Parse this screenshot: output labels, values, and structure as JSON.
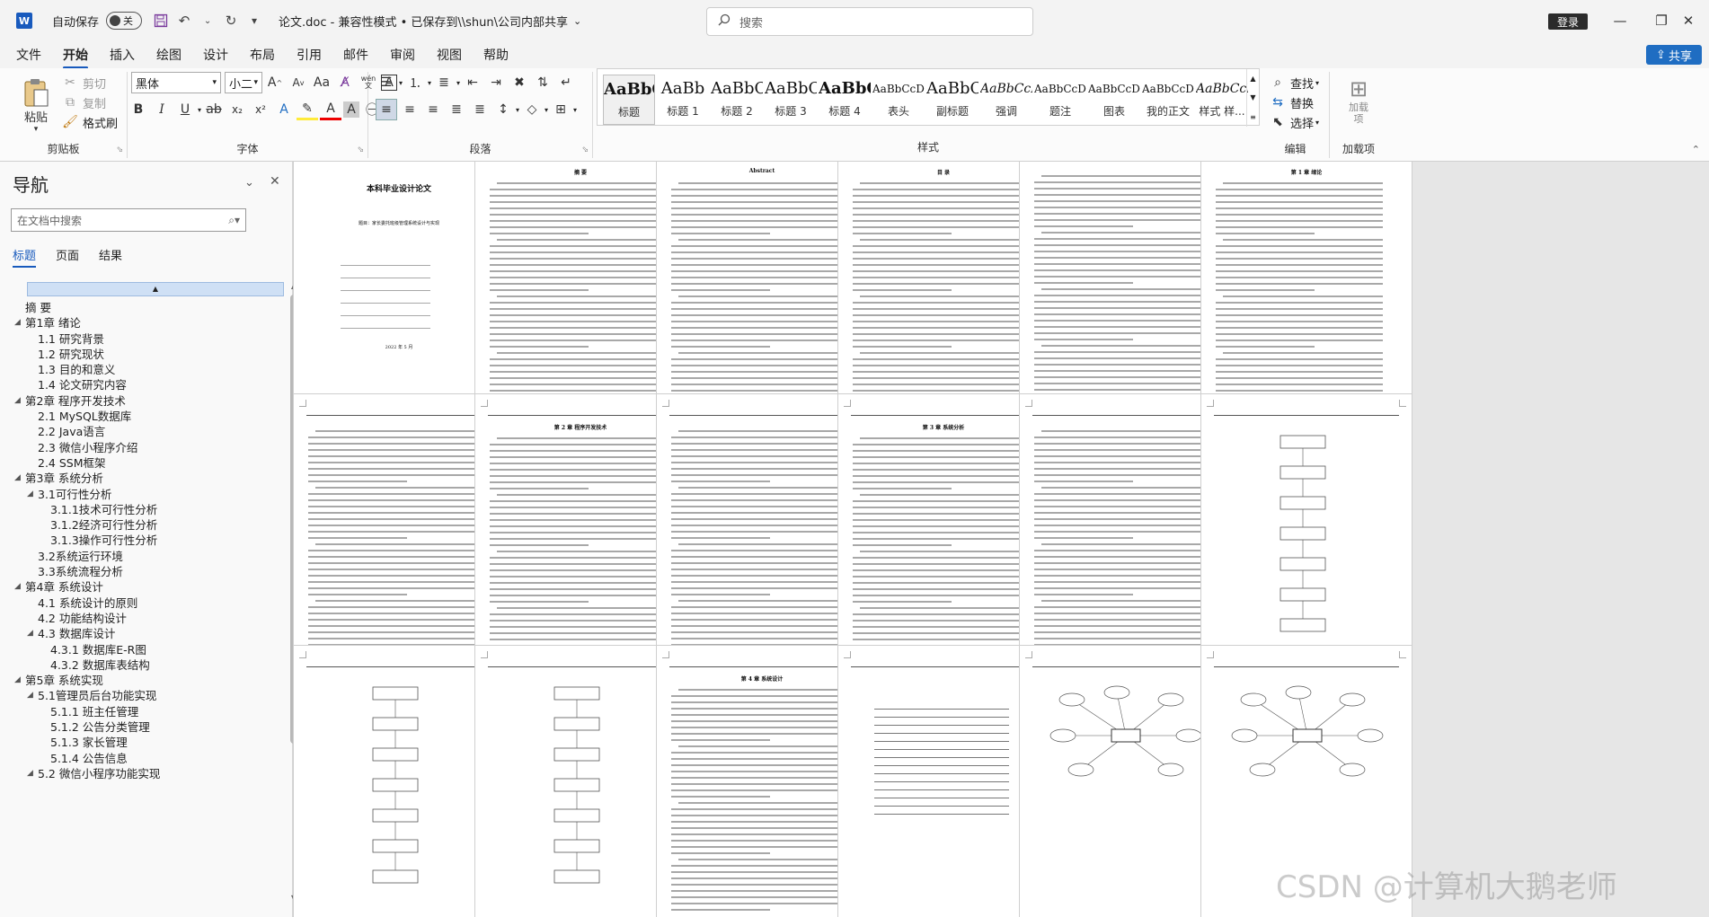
{
  "titlebar": {
    "autosave_label": "自动保存",
    "autosave_state": "关",
    "document_title": "论文.doc  -  兼容性模式 • 已保存到\\\\shun\\公司内部共享",
    "search_placeholder": "搜索",
    "login_label": "登录"
  },
  "menu": {
    "tabs": [
      "文件",
      "开始",
      "插入",
      "绘图",
      "设计",
      "布局",
      "引用",
      "邮件",
      "审阅",
      "视图",
      "帮助"
    ],
    "active": "开始",
    "share_label": "共享"
  },
  "ribbon": {
    "clipboard": {
      "paste": "粘贴",
      "cut": "剪切",
      "copy": "复制",
      "format_painter": "格式刷",
      "label": "剪贴板"
    },
    "font": {
      "name": "黑体",
      "size": "小二",
      "label": "字体",
      "case_label": "Aa",
      "pinyin": "wén"
    },
    "paragraph": {
      "label": "段落"
    },
    "styles": {
      "label": "样式",
      "items": [
        {
          "sample": "AaBbC",
          "name": "标题"
        },
        {
          "sample": "AaBb",
          "name": "标题 1"
        },
        {
          "sample": "AaBbC",
          "name": "标题 2"
        },
        {
          "sample": "AaBbC",
          "name": "标题 3"
        },
        {
          "sample": "AaBbC",
          "name": "标题 4"
        },
        {
          "sample": "AaBbCcDd",
          "name": "表头"
        },
        {
          "sample": "AaBbC",
          "name": "副标题"
        },
        {
          "sample": "AaBbCcI",
          "name": "强调"
        },
        {
          "sample": "AaBbCcDd",
          "name": "题注"
        },
        {
          "sample": "AaBbCcDd",
          "name": "图表"
        },
        {
          "sample": "AaBbCcDd",
          "name": "我的正文"
        },
        {
          "sample": "AaBbCcI",
          "name": "样式 样..."
        }
      ]
    },
    "editing": {
      "find": "查找",
      "replace": "替换",
      "select": "选择",
      "label": "编辑"
    },
    "addins": {
      "button": "加载项",
      "label": "加载项"
    }
  },
  "nav": {
    "title": "导航",
    "search_placeholder": "在文档中搜索",
    "tabs": [
      "标题",
      "页面",
      "结果"
    ],
    "active_tab": "标题",
    "items": [
      {
        "label": "摘  要",
        "level": 0,
        "tri": ""
      },
      {
        "label": "第1章 绪论",
        "level": 0,
        "tri": "◢"
      },
      {
        "label": "1.1 研究背景",
        "level": 1,
        "tri": ""
      },
      {
        "label": "1.2 研究现状",
        "level": 1,
        "tri": ""
      },
      {
        "label": "1.3 目的和意义",
        "level": 1,
        "tri": ""
      },
      {
        "label": "1.4 论文研究内容",
        "level": 1,
        "tri": ""
      },
      {
        "label": "第2章 程序开发技术",
        "level": 0,
        "tri": "◢"
      },
      {
        "label": "2.1 MySQL数据库",
        "level": 1,
        "tri": ""
      },
      {
        "label": "2.2 Java语言",
        "level": 1,
        "tri": ""
      },
      {
        "label": "2.3 微信小程序介绍",
        "level": 1,
        "tri": ""
      },
      {
        "label": "2.4 SSM框架",
        "level": 1,
        "tri": ""
      },
      {
        "label": "第3章 系统分析",
        "level": 0,
        "tri": "◢"
      },
      {
        "label": "3.1可行性分析",
        "level": 1,
        "tri": "◢"
      },
      {
        "label": "3.1.1技术可行性分析",
        "level": 2,
        "tri": ""
      },
      {
        "label": "3.1.2经济可行性分析",
        "level": 2,
        "tri": ""
      },
      {
        "label": "3.1.3操作可行性分析",
        "level": 2,
        "tri": ""
      },
      {
        "label": "3.2系统运行环境",
        "level": 1,
        "tri": ""
      },
      {
        "label": "3.3系统流程分析",
        "level": 1,
        "tri": ""
      },
      {
        "label": "第4章 系统设计",
        "level": 0,
        "tri": "◢"
      },
      {
        "label": "4.1 系统设计的原则",
        "level": 1,
        "tri": ""
      },
      {
        "label": "4.2 功能结构设计",
        "level": 1,
        "tri": ""
      },
      {
        "label": "4.3 数据库设计",
        "level": 1,
        "tri": "◢"
      },
      {
        "label": "4.3.1 数据库E-R图",
        "level": 2,
        "tri": ""
      },
      {
        "label": "4.3.2 数据库表结构",
        "level": 2,
        "tri": ""
      },
      {
        "label": "第5章 系统实现",
        "level": 0,
        "tri": "◢"
      },
      {
        "label": "5.1管理员后台功能实现",
        "level": 1,
        "tri": "◢"
      },
      {
        "label": "5.1.1 班主任管理",
        "level": 2,
        "tri": ""
      },
      {
        "label": "5.1.2 公告分类管理",
        "level": 2,
        "tri": ""
      },
      {
        "label": "5.1.3 家长管理",
        "level": 2,
        "tri": ""
      },
      {
        "label": "5.1.4 公告信息",
        "level": 2,
        "tri": ""
      },
      {
        "label": "5.2 微信小程序功能实现",
        "level": 1,
        "tri": "◢"
      }
    ]
  },
  "pages": {
    "cover": {
      "title": "本科毕业设计论文",
      "subtitle": "题目：家长委托班级管理系统设计与实现",
      "date": "2022 年 5 月"
    },
    "abstract_cn": {
      "title": "摘  要"
    },
    "abstract_en": {
      "title": "Abstract"
    },
    "toc": {
      "title": "目  录"
    },
    "ch1": {
      "title": "第 1 章  绪论"
    },
    "ch2": {
      "title": "第 2 章  程序开发技术"
    },
    "ch3": {
      "title": "第 3 章  系统分析"
    },
    "ch4": {
      "title": "第 4 章  系统设计"
    }
  },
  "watermark": "CSDN @计算机大鹅老师",
  "colors": {
    "accent": "#185abd",
    "share": "#1f6dc2"
  }
}
